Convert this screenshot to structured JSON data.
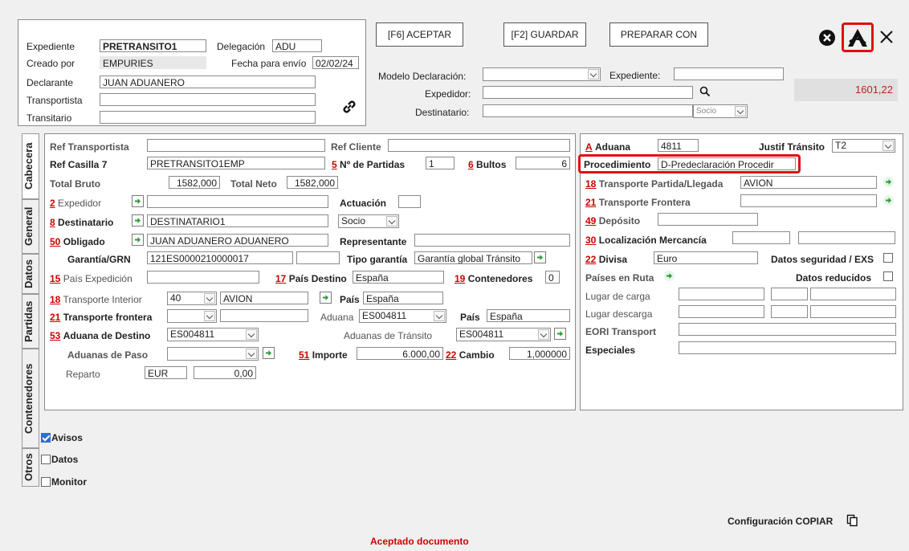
{
  "header": {
    "expediente_label": "Expediente",
    "expediente_value": "PRETRANSITO1",
    "delegacion_label": "Delegación",
    "delegacion_value": "ADU",
    "creado_label": "Creado por",
    "creado_value": "EMPURIES",
    "fecha_label": "Fecha para envío",
    "fecha_value": "02/02/24",
    "declarante_label": "Declarante",
    "declarante_value": "JUAN ADUANERO",
    "transportista_label": "Transportista",
    "transportista_value": "",
    "transitario_label": "Transitario",
    "transitario_value": ""
  },
  "toolbar": {
    "aceptar": "[F6] ACEPTAR",
    "guardar": "[F2] GUARDAR",
    "preparar": "PREPARAR CON"
  },
  "search": {
    "modelo_label": "Modelo Declaración:",
    "modelo_value": "",
    "expediente_label": "Expediente:",
    "expediente_value": "",
    "expedidor_label": "Expedidor:",
    "expedidor_value": "",
    "destinatario_label": "Destinatario:",
    "destinatario_value": "",
    "socio_value": "Socio"
  },
  "amount": "1601,22",
  "tabs": [
    "Cabecera",
    "General",
    "Datos",
    "Partidas",
    "Contenedores",
    "Otros"
  ],
  "left": {
    "ref_transportista": "Ref Transportista",
    "ref_cliente": "Ref Cliente",
    "ref_casilla": "Ref Casilla 7",
    "ref_casilla_value": "PRETRANSITO1EMP",
    "num_partidas_n": "5",
    "num_partidas": "Nº de Partidas",
    "num_partidas_value": "1",
    "bultos_n": "6",
    "bultos": "Bultos",
    "bultos_value": "6",
    "total_bruto": "Total Bruto",
    "total_bruto_value": "1582,000",
    "total_neto": "Total Neto",
    "total_neto_value": "1582,000",
    "expedidor_n": "2",
    "expedidor": "Expedidor",
    "actuacion": "Actuación",
    "destinatario_n": "8",
    "destinatario": "Destinatario",
    "destinatario_value": "DESTINATARIO1",
    "socio": "Socio",
    "obligado_n": "50",
    "obligado": "Obligado",
    "obligado_value": "JUAN ADUANERO ADUANERO",
    "representante": "Representante",
    "garantia": "Garantía/GRN",
    "garantia_value": "121ES0000210000017",
    "tipo_garantia": "Tipo garantía",
    "tipo_garantia_value": "Garantía global Tránsito",
    "pais_exp_n": "15",
    "pais_exp": "País Expedición",
    "pais_dest_n": "17",
    "pais_dest": "País Destino",
    "pais_dest_value": "España",
    "contenedores_n": "19",
    "contenedores": "Contenedores",
    "contenedores_value": "0",
    "transp_int_n": "18",
    "transp_int": "Transporte Interior",
    "transp_int_code": "40",
    "transp_int_value": "AVION",
    "pais": "País",
    "pais_value": "España",
    "transp_front_n": "21",
    "transp_front": "Transporte frontera",
    "aduana": "Aduana",
    "aduana_value": "ES004811",
    "pais2": "País",
    "pais2_value": "España",
    "aduana_dest_n": "53",
    "aduana_dest": "Aduana de Destino",
    "aduana_dest_value": "ES004811",
    "aduanas_transito": "Aduanas de Tránsito",
    "aduanas_transito_value": "ES004811",
    "aduanas_paso": "Aduanas de Paso",
    "importe_n": "51",
    "importe": "Importe",
    "importe_value": "6.000,00",
    "cambio_n": "22",
    "cambio": "Cambio",
    "cambio_value": "1,000000",
    "reparto": "Reparto",
    "reparto_cur": "EUR",
    "reparto_value": "0,00"
  },
  "right": {
    "aduana_n": "A",
    "aduana": "Aduana",
    "aduana_value": "4811",
    "justif": "Justif Tránsito",
    "justif_value": "T2",
    "procedimiento": "Procedimiento",
    "procedimiento_value": "D-Predeclaración Procedir",
    "tpl_n": "18",
    "tpl": "Transporte Partida/Llegada",
    "tpl_value": "AVION",
    "tf_n": "21",
    "tf": "Transporte Frontera",
    "deposito_n": "49",
    "deposito": "Depósito",
    "loc_n": "30",
    "loc": "Localización Mercancía",
    "divisa_n": "22",
    "divisa": "Divisa",
    "divisa_value": "Euro",
    "datos_seg": "Datos seguridad / EXS",
    "paises_ruta": "Países en Ruta",
    "datos_red": "Datos reducidos",
    "lugar_carga": "Lugar de carga",
    "lugar_descarga": "Lugar descarga",
    "eori": "EORI Transport",
    "especiales": "Especiales"
  },
  "checks": {
    "avisos": "Avisos",
    "datos": "Datos",
    "monitor": "Monitor"
  },
  "config_copiar": "Configuración COPIAR",
  "status": "Aceptado documento",
  "colors": {
    "accent_red": "#e01010",
    "link_red": "#cc0000",
    "check_blue": "#2f6fcf"
  }
}
